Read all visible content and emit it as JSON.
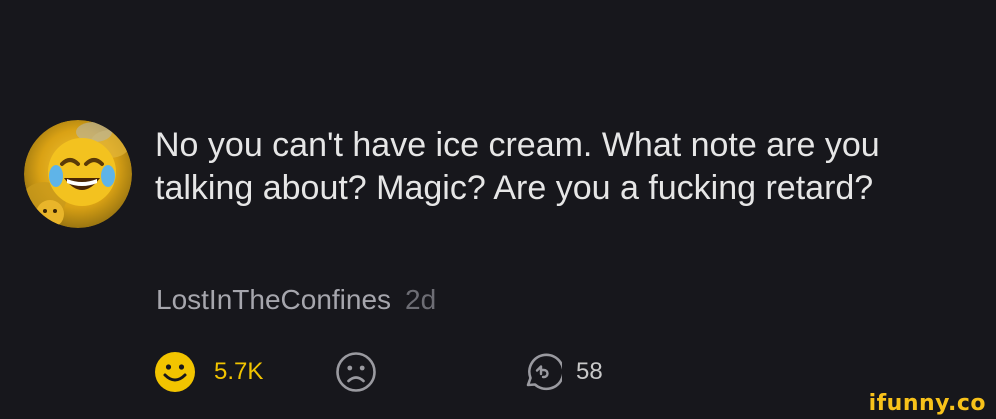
{
  "comment": {
    "text": "No you can't have ice cream. What note are you talking about? Magic? Are you a fucking retard?",
    "author": "LostInTheConfines",
    "age": "2d"
  },
  "reactions": {
    "smile": {
      "icon": "smile-icon",
      "count": "5.7K",
      "color": "#f2c400"
    },
    "frown": {
      "icon": "frown-icon"
    },
    "reply": {
      "icon": "reply-icon",
      "count": "58"
    }
  },
  "avatar": {
    "icon": "laughing-emoji-avatar"
  },
  "watermark": {
    "text": "ifunny.co",
    "color": "#f8c21a"
  }
}
